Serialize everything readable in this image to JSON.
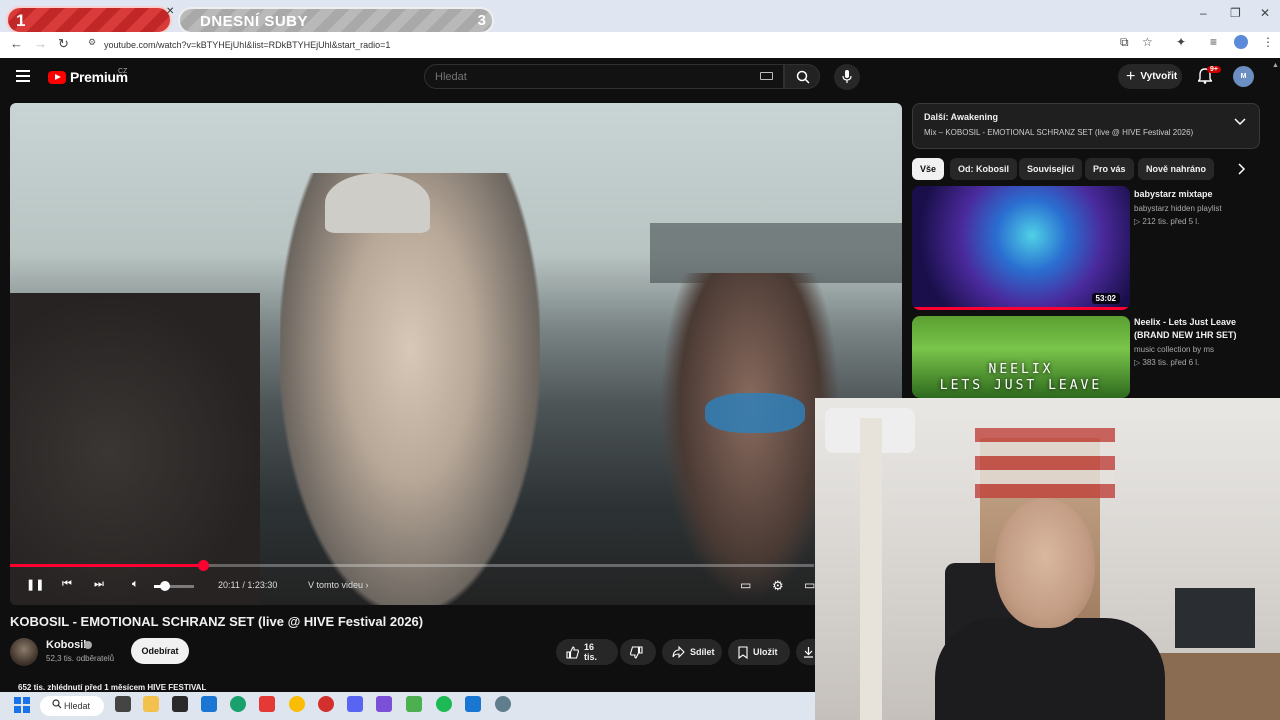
{
  "overlay": {
    "left_counter": "1",
    "title": "DNESNÍ SUBY",
    "right_counter": "3"
  },
  "browser": {
    "url": "youtube.com/watch?v=kBTYHEjUhl&list=RDkBTYHEjUhl&start_radio=1"
  },
  "header": {
    "logo": "Premium",
    "logo_country": "CZ",
    "search_placeholder": "Hledat",
    "create_label": "Vytvořit",
    "notif_count": "9+",
    "avatar_initials": "M"
  },
  "player": {
    "progress": 0.24,
    "volume": 0.2,
    "time": "20:11 / 1:23:30",
    "chapter_label": "V tomto videu"
  },
  "video": {
    "title": "KOBOSIL - EMOTIONAL SCHRANZ SET (live @ HIVE Festival 2026)",
    "channel": "Kobosil",
    "subscribers": "52,3 tis. odběratelů",
    "subscribe_label": "Odebírat",
    "likes": "16 tis.",
    "share_label": "Sdílet",
    "save_label": "Uložit",
    "description_line": "652 tis. zhlédnutí  před 1 měsícem  HIVE FESTIVAL"
  },
  "playlist": {
    "next_label": "Další: Awakening",
    "mix_label": "Mix – KOBOSIL - EMOTIONAL SCHRANZ SET (live @ HIVE Festival 2026)"
  },
  "chips": [
    "Vše",
    "Od: Kobosil",
    "Související",
    "Pro vás",
    "Nově nahráno"
  ],
  "recommendations": [
    {
      "title": "babystarz mixtape",
      "channel": "babystarz hidden playlist",
      "meta": "▷ 212 tis.  před 5 l.",
      "duration": "53:02"
    },
    {
      "title": "Neelix - Lets Just Leave (BRAND NEW 1HR SET)",
      "channel": "music collection by ms",
      "meta": "▷ 383 tis.  před 6 l.",
      "thumb_text_1": "NEELIX",
      "thumb_text_2": "LETS JUST LEAVE"
    }
  ],
  "taskbar": {
    "search_label": "Hledat"
  },
  "colors": {
    "accent_red": "#ff0033",
    "background": "#0f0f0f"
  }
}
